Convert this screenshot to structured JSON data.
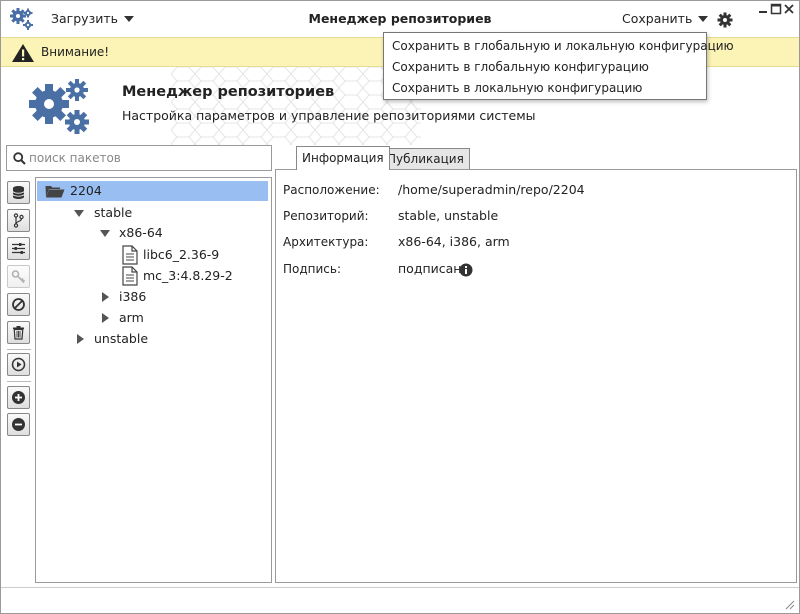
{
  "titlebar": {
    "load_label": "Загрузить",
    "title": "Менеджер репозиториев",
    "save_label": "Сохранить"
  },
  "warning": {
    "text": "Внимание!"
  },
  "header": {
    "title": "Менеджер репозиториев",
    "subtitle": "Настройка параметров и управление репозиториями системы"
  },
  "save_dropdown": {
    "items": [
      "Сохранить в глобальную и локальную конфигурацию",
      "Сохранить в глобальную конфигурацию",
      "Сохранить в локальную конфигурацию"
    ]
  },
  "search": {
    "placeholder": "поиск пакетов"
  },
  "toolbar": {
    "icons": [
      "database-icon",
      "branch-icon",
      "sliders-icon",
      "key-icon",
      "block-icon",
      "trash-icon",
      "play-icon",
      "plus-icon",
      "minus-icon"
    ]
  },
  "tree": {
    "root": "2204",
    "stable": "stable",
    "arch_x86": "x86-64",
    "pkg1": "libc6_2.36-9",
    "pkg2": "mc_3:4.8.29-2",
    "arch_i386": "i386",
    "arch_arm": "arm",
    "unstable": "unstable"
  },
  "tabs": {
    "info": "Информация",
    "publish": "Публикация"
  },
  "info": {
    "location_label": "Расположение:",
    "location_value": "/home/superadmin/repo/2204",
    "repo_label": "Репозиторий:",
    "repo_value": "stable, unstable",
    "arch_label": "Архитектура:",
    "arch_value": "x86-64, i386, arm",
    "sign_label": "Подпись:",
    "sign_value": "подписан"
  },
  "colors": {
    "accent": "#4a6fa5",
    "selection": "#99bff2",
    "warning_bg": "#fcf3b6"
  }
}
